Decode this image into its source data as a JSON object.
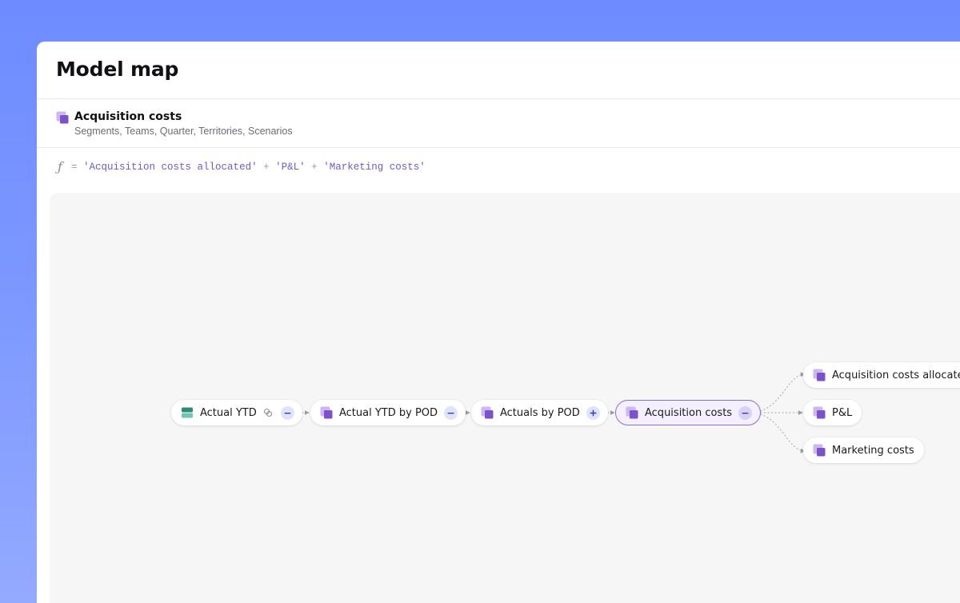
{
  "page": {
    "title": "Model map"
  },
  "block": {
    "name": "Acquisition costs",
    "dimensions": "Segments, Teams, Quarter, Territories, Scenarios"
  },
  "formula": {
    "icon": "function-icon",
    "eq": "=",
    "plus": "+",
    "refs": [
      "'Acquisition costs allocated'",
      "'P&L'",
      "'Marketing costs'"
    ]
  },
  "nodes": [
    {
      "label": "Actual YTD",
      "icon": "table-icon",
      "toggle": "collapse",
      "linked": true
    },
    {
      "label": "Actual YTD by POD",
      "icon": "block-icon",
      "toggle": "collapse"
    },
    {
      "label": "Actuals by POD",
      "icon": "block-icon",
      "toggle": "expand"
    },
    {
      "label": "Acquisition costs",
      "icon": "block-icon",
      "toggle": "collapse",
      "selected": true
    },
    {
      "label": "Acquisition costs allocated",
      "icon": "block-icon"
    },
    {
      "label": "P&L",
      "icon": "block-icon"
    },
    {
      "label": "Marketing costs",
      "icon": "block-icon"
    }
  ],
  "colors": {
    "accent": "#8a6ce0",
    "block_icon": "#7b52c9",
    "table_icon": "#45b19c",
    "background": "#6e8cff"
  }
}
